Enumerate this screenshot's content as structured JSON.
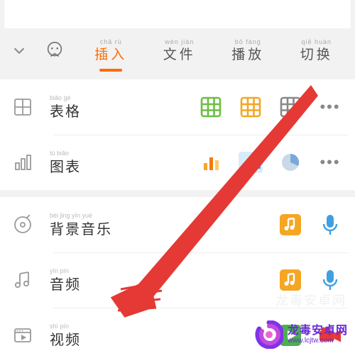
{
  "tabs": {
    "items": [
      {
        "pinyin": "chā rù",
        "label": "插入",
        "active": true
      },
      {
        "pinyin": "wén jiàn",
        "label": "文件",
        "active": false
      },
      {
        "pinyin": "bō fàng",
        "label": "播放",
        "active": false
      },
      {
        "pinyin": "qiē huàn",
        "label": "切换",
        "active": false
      }
    ]
  },
  "groups": [
    {
      "rows": [
        {
          "icon": "table",
          "pinyin": "biǎo gé",
          "label": "表格",
          "trail": [
            "grid-green",
            "grid-orange",
            "grid-gray",
            "more"
          ]
        },
        {
          "icon": "bars",
          "pinyin": "tú biǎo",
          "label": "图表",
          "trail": [
            "bars-orange",
            "area-blue",
            "pie-blue",
            "more"
          ]
        }
      ]
    },
    {
      "rows": [
        {
          "icon": "disc",
          "pinyin": "bèi jǐng yīn yuè",
          "label": "背景音乐",
          "trail": [
            "music-box",
            "mic"
          ]
        },
        {
          "icon": "note",
          "pinyin": "yīn pín",
          "label": "音频",
          "trail": [
            "music-box",
            "mic"
          ]
        },
        {
          "icon": "video",
          "pinyin": "shì pín",
          "label": "视频",
          "trail": [
            "play-box",
            "cam"
          ]
        }
      ]
    }
  ],
  "watermark": {
    "faint": "龙毒安卓网",
    "cn": "龙毒安卓网",
    "url": "www.lcjtw.com"
  },
  "colors": {
    "accent": "#ff6a00",
    "green": "#6bbf3f",
    "orange": "#f5a623",
    "blue": "#3fa0e0",
    "blue2": "#7aa8d8",
    "red": "#e53935",
    "purple": "#6b29d9"
  }
}
